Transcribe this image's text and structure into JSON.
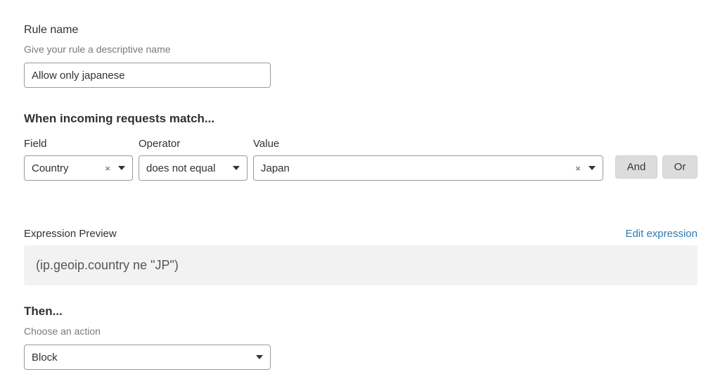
{
  "rule_name": {
    "label": "Rule name",
    "help": "Give your rule a descriptive name",
    "value": "Allow only japanese"
  },
  "match": {
    "heading": "When incoming requests match...",
    "field_label": "Field",
    "operator_label": "Operator",
    "value_label": "Value",
    "field_value": "Country",
    "operator_value": "does not equal",
    "value_value": "Japan",
    "and_label": "And",
    "or_label": "Or",
    "clear_glyph": "×"
  },
  "expression": {
    "label": "Expression Preview",
    "edit_label": "Edit expression",
    "preview": "(ip.geoip.country ne \"JP\")"
  },
  "then": {
    "heading": "Then...",
    "help": "Choose an action",
    "action_value": "Block"
  },
  "colors": {
    "link": "#2c7cb0",
    "button_bg": "#dcdcdc",
    "preview_bg": "#f2f2f2"
  }
}
